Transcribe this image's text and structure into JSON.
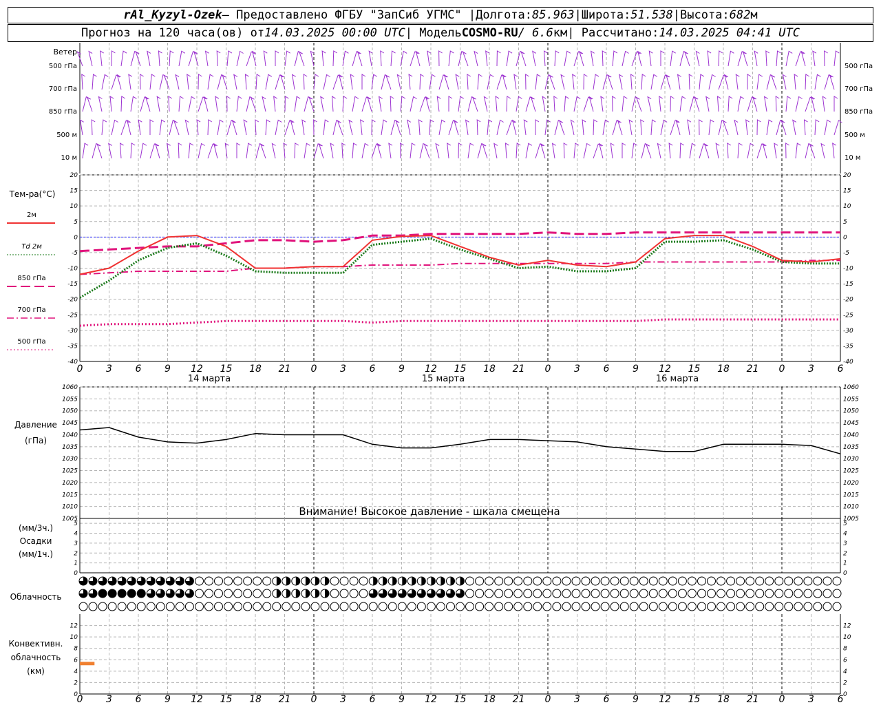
{
  "header": {
    "station": "rAl_Kyzyl-Ozek",
    "provider": " — Предоставлено ФГБУ \"ЗапСиб УГМС\" | ",
    "lon_label": "Долгота: ",
    "lon": "85.963",
    "sep1": " | ",
    "lat_label": "Широта: ",
    "lat": "51.538",
    "sep2": " | ",
    "alt_label": "Высота: ",
    "alt": "682",
    "alt_unit": "м"
  },
  "subheader": {
    "forecast_label": "Прогноз на 120 часа(ов) от ",
    "start": "14.03.2025 00:00 UTC",
    "model_label": "  | Модель ",
    "model": "COSMO-RU",
    "res": " / 6.6",
    "res_unit": "км",
    "calc_label": " | Рассчитано: ",
    "calc": "14.03.2025 04:41 UTC"
  },
  "wind": {
    "title": "Ветер",
    "levels": [
      "500 гПа",
      "700 гПа",
      "850 гПа",
      "500 м",
      "10  м"
    ]
  },
  "temperature": {
    "title": "Тем-ра(°C)",
    "legend": [
      {
        "label": "2м",
        "color": "#f03232",
        "dash": "solid"
      },
      {
        "label": "Td  2м",
        "color": "#1a7a1a",
        "dash": "dotted"
      },
      {
        "label": "850 гПа",
        "color": "#e0147c",
        "dash": "long-dash"
      },
      {
        "label": "700 гПа",
        "color": "#e0147c",
        "dash": "dash-dot"
      },
      {
        "label": "500 гПа",
        "color": "#e0147c",
        "dash": "dots"
      }
    ],
    "ylim": [
      -40,
      20
    ],
    "yticks": [
      20,
      15,
      10,
      5,
      0,
      -5,
      -10,
      -15,
      -20,
      -25,
      -30,
      -35,
      -40
    ]
  },
  "time_axis": {
    "hour_labels": [
      "0",
      "3",
      "6",
      "9",
      "12",
      "15",
      "18",
      "21",
      "0",
      "3",
      "6",
      "9",
      "12",
      "15",
      "18",
      "21",
      "0",
      "3",
      "6",
      "9",
      "12",
      "15",
      "18",
      "21",
      "0",
      "3",
      "6"
    ],
    "day_labels": [
      "14 марта",
      "15 марта",
      "16 марта"
    ]
  },
  "pressure": {
    "title": "Давление",
    "unit": "(гПа)",
    "warning": "Внимание! Высокое давление - шкала смещена",
    "yticks": [
      1060,
      1055,
      1050,
      1045,
      1040,
      1035,
      1030,
      1025,
      1020,
      1015,
      1010,
      1005
    ]
  },
  "precip": {
    "unit3h": "(мм/3ч.)",
    "title": "Осадки",
    "unit1h": "(мм/1ч.)",
    "yticks": [
      5,
      4,
      3,
      2,
      1,
      0
    ]
  },
  "cloud": {
    "title": "Облачность"
  },
  "convective": {
    "title1": "Конвективн.",
    "title2": "облачность",
    "unit": "(км)",
    "yticks": [
      12,
      10,
      8,
      6,
      4,
      2,
      0
    ]
  },
  "chart_data": [
    {
      "type": "line",
      "title": "Тем-ра(°C)",
      "x_hours": [
        0,
        3,
        6,
        9,
        12,
        15,
        18,
        21,
        24,
        27,
        30,
        33,
        36,
        39,
        42,
        45,
        48,
        51,
        54,
        57,
        60,
        63,
        66,
        69,
        72,
        75,
        78
      ],
      "ylim": [
        -40,
        20
      ],
      "series": [
        {
          "name": "2м",
          "values": [
            -12,
            -10,
            -4.5,
            0,
            0.5,
            -3,
            -10,
            -10,
            -9.5,
            -9.5,
            -1,
            0.2,
            0.5,
            -3,
            -6.5,
            -9,
            -7.5,
            -9,
            -9.5,
            -8,
            -0.5,
            0.5,
            0.5,
            -3,
            -7.5,
            -8,
            -7
          ]
        },
        {
          "name": "Td  2м",
          "values": [
            -19.5,
            -14,
            -7.5,
            -3.5,
            -2,
            -6,
            -11,
            -11.5,
            -11.5,
            -11.5,
            -2.5,
            -1.5,
            -0.5,
            -4,
            -7,
            -10,
            -9.5,
            -11,
            -11,
            -10,
            -1.5,
            -1.5,
            -1,
            -4,
            -8,
            -8.5,
            -8.5
          ]
        },
        {
          "name": "850 гПа",
          "values": [
            -4.5,
            -4,
            -3.5,
            -3,
            -3,
            -2,
            -1,
            -1,
            -1.5,
            -1,
            0.5,
            0.5,
            1,
            1,
            1,
            1,
            1.5,
            1,
            1,
            1.5,
            1.5,
            1.5,
            1.5,
            1.5,
            1.5,
            1.5,
            1.5
          ]
        },
        {
          "name": "700 гПа",
          "values": [
            -12,
            -11.5,
            -11,
            -11,
            -11,
            -11,
            -10,
            -10,
            -9.5,
            -9.5,
            -9,
            -9,
            -9,
            -8.5,
            -8.5,
            -8.5,
            -8.5,
            -8.5,
            -8.5,
            -8,
            -8,
            -8,
            -8,
            -8,
            -8,
            -7.5,
            -7.5
          ]
        },
        {
          "name": "500 гПа",
          "values": [
            -28.5,
            -28,
            -28,
            -28,
            -27.5,
            -27,
            -27,
            -27,
            -27,
            -27,
            -27.5,
            -27,
            -27,
            -27,
            -27,
            -27,
            -27,
            -27,
            -27,
            -27,
            -26.5,
            -26.5,
            -26.5,
            -26.5,
            -26.5,
            -26.5,
            -26.5
          ]
        }
      ]
    },
    {
      "type": "line",
      "title": "Давление",
      "x_hours": [
        0,
        3,
        6,
        9,
        12,
        15,
        18,
        21,
        24,
        27,
        30,
        33,
        36,
        39,
        42,
        45,
        48,
        51,
        54,
        57,
        60,
        63,
        66,
        69,
        72,
        75,
        78
      ],
      "ylim": [
        1005,
        1060
      ],
      "series": [
        {
          "name": "Давление",
          "values": [
            1042,
            1043,
            1039,
            1037,
            1036.5,
            1038,
            1040.5,
            1040,
            1040,
            1040,
            1036,
            1034.5,
            1034.5,
            1036,
            1038,
            1038,
            1037.5,
            1037,
            1035,
            1034,
            1033,
            1033,
            1036,
            1036,
            1036,
            1035.5,
            1032
          ]
        }
      ]
    },
    {
      "type": "bar",
      "title": "Осадки",
      "ylim": [
        0,
        5
      ],
      "values": []
    },
    {
      "type": "bar",
      "title": "Конвективн. облачность",
      "ylim": [
        0,
        13
      ],
      "ranges": [
        {
          "x_from": 0,
          "x_to": 1.5,
          "y_from": 5,
          "y_to": 5.4
        }
      ]
    }
  ],
  "colors": {
    "wind": "#9b30d0",
    "t2m": "#f03232",
    "td2m": "#1a7a1a",
    "upper": "#e0147c",
    "zero": "#3c3cff",
    "conv": "#f08030"
  }
}
